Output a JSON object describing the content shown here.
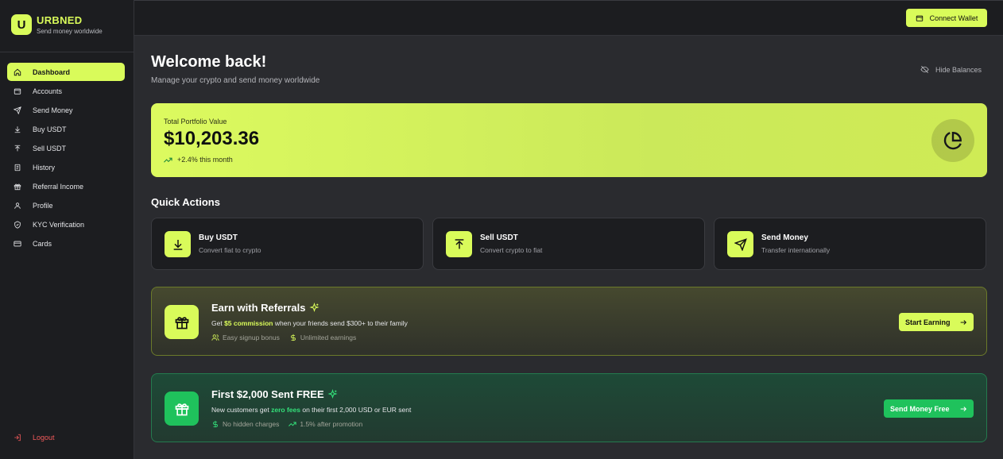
{
  "brand": {
    "logo_letter": "U",
    "name": "URBNED",
    "tagline": "Send money worldwide"
  },
  "sidebar": {
    "items": [
      {
        "label": "Dashboard",
        "icon": "home-icon",
        "active": true
      },
      {
        "label": "Accounts",
        "icon": "wallet-icon"
      },
      {
        "label": "Send Money",
        "icon": "send-icon"
      },
      {
        "label": "Buy USDT",
        "icon": "download-icon"
      },
      {
        "label": "Sell USDT",
        "icon": "upload-icon"
      },
      {
        "label": "History",
        "icon": "receipt-icon"
      },
      {
        "label": "Referral Income",
        "icon": "gift-icon"
      },
      {
        "label": "Profile",
        "icon": "user-icon"
      },
      {
        "label": "KYC Verification",
        "icon": "shield-check-icon"
      },
      {
        "label": "Cards",
        "icon": "credit-card-icon"
      }
    ],
    "logout_label": "Logout"
  },
  "topbar": {
    "connect_wallet_label": "Connect Wallet"
  },
  "header": {
    "title": "Welcome back!",
    "subtitle": "Manage your crypto and send money worldwide",
    "hide_balances_label": "Hide Balances"
  },
  "portfolio": {
    "label": "Total Portfolio Value",
    "value": "$10,203.36",
    "change": "+2.4% this month"
  },
  "quick_actions": {
    "title": "Quick Actions",
    "items": [
      {
        "name": "Buy USDT",
        "desc": "Convert fiat to crypto",
        "icon": "download-icon"
      },
      {
        "name": "Sell USDT",
        "desc": "Convert crypto to fiat",
        "icon": "upload-icon"
      },
      {
        "name": "Send Money",
        "desc": "Transfer internationally",
        "icon": "send-icon"
      }
    ]
  },
  "referral": {
    "title": "Earn with Referrals",
    "text_pre": "Get ",
    "text_highlight": "$5 commission",
    "text_post": " when your friends send $300+ to their family",
    "tags": [
      "Easy signup bonus",
      "Unlimited earnings"
    ],
    "button_label": "Start Earning"
  },
  "free_promo": {
    "title": "First $2,000 Sent FREE",
    "text_pre": "New customers get ",
    "text_highlight": "zero fees",
    "text_post": " on their first 2,000 USD or EUR sent",
    "tags": [
      "No hidden charges",
      "1.5% after promotion"
    ],
    "button_label": "Send Money Free"
  },
  "colors": {
    "accent": "#d9fb5a",
    "success": "#1fc25c",
    "danger": "#f0595a",
    "sidebar_bg": "#1c1d20",
    "page_bg": "#2a2b2f"
  }
}
